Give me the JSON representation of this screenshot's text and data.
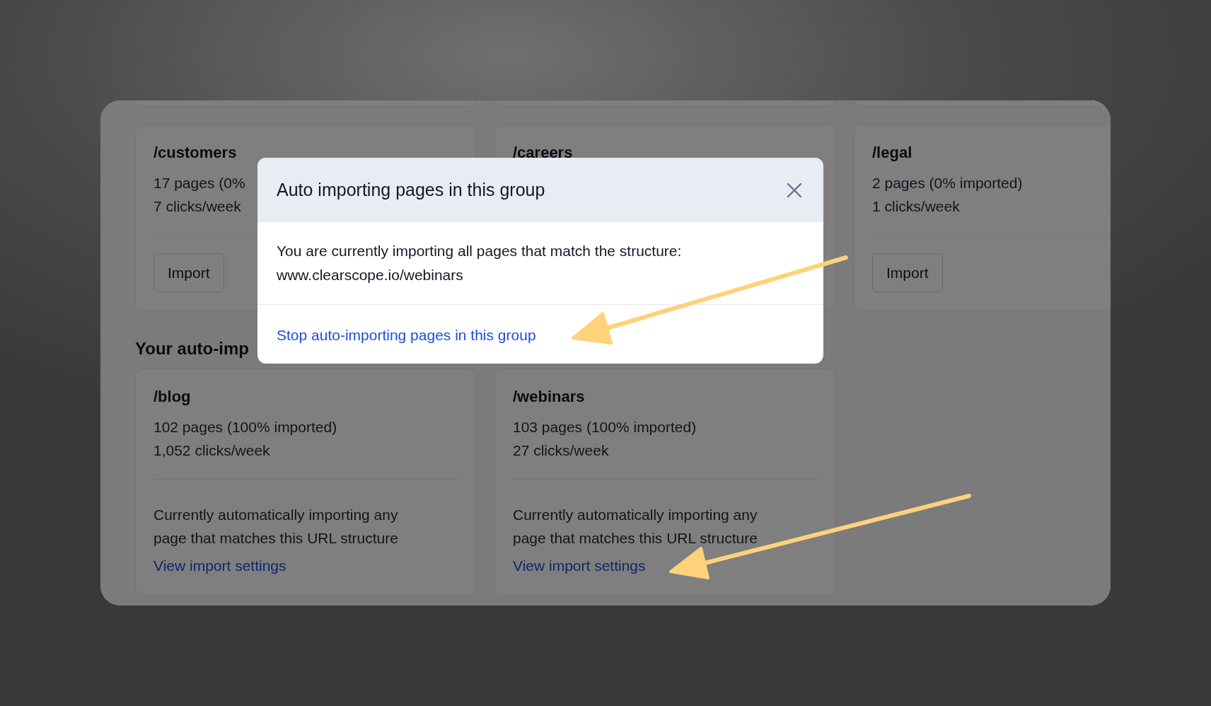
{
  "page_groups": [
    {
      "path": "/customers",
      "lines": [
        "17 pages (0%",
        "7 clicks/week"
      ],
      "button": "Import"
    },
    {
      "path": "/careers"
    },
    {
      "path": "/legal",
      "lines": [
        "2 pages (0% imported)",
        "1 clicks/week"
      ],
      "button": "Import"
    }
  ],
  "auto_section": {
    "heading": "Your auto-imp",
    "groups": [
      {
        "path": "/blog",
        "lines": [
          "102 pages (100% imported)",
          "1,052 clicks/week"
        ],
        "note": "Currently automatically importing any page that matches this URL structure",
        "link": "View import settings"
      },
      {
        "path": "/webinars",
        "lines": [
          "103 pages (100% imported)",
          "27 clicks/week"
        ],
        "note": "Currently automatically importing any page that matches this URL structure",
        "link": "View import settings"
      }
    ]
  },
  "modal": {
    "title": "Auto importing pages in this group",
    "body": "You are currently importing all pages that match the structure:",
    "url": "www.clearscope.io/webinars",
    "action": "Stop auto-importing pages in this group"
  }
}
